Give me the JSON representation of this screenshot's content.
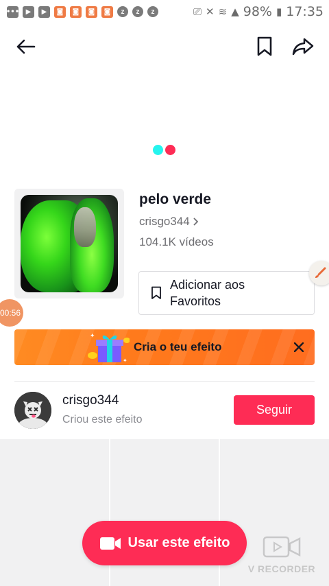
{
  "status_bar": {
    "battery": "98%",
    "time": "17:35"
  },
  "nav": {
    "back_icon": "arrow-left-icon",
    "bookmark_icon": "bookmark-icon",
    "share_icon": "share-icon"
  },
  "effect": {
    "title": "pelo verde",
    "creator": "crisgo344",
    "video_count": "104.1K vídeos",
    "favorite_label": "Adicionar aos Favoritos"
  },
  "side_bubbles": {
    "timer": "00:56"
  },
  "banner": {
    "text": "Cria o teu efeito"
  },
  "creator_row": {
    "name": "crisgo344",
    "subtitle": "Criou este efeito",
    "follow_label": "Seguir"
  },
  "cta": {
    "label": "Usar este efeito"
  },
  "watermark": {
    "text": "V RECORDER"
  },
  "colors": {
    "accent": "#fe2c55",
    "banner": "#ff7a1c",
    "dot_cyan": "#25f4ee",
    "dot_pink": "#fe2c55"
  }
}
